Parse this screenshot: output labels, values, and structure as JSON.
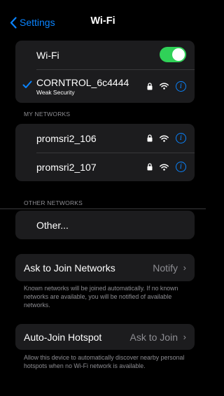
{
  "nav": {
    "back_label": "Settings",
    "title": "Wi-Fi"
  },
  "wifi_group": {
    "wifi_label": "Wi-Fi",
    "wifi_enabled": true,
    "connected": {
      "name": "CORNTROL_6c4444",
      "status": "Weak Security"
    }
  },
  "my_networks": {
    "header": "MY NETWORKS",
    "items": [
      {
        "name": "promsri2_106"
      },
      {
        "name": "promsri2_107"
      }
    ]
  },
  "other_networks": {
    "header": "OTHER NETWORKS",
    "other_label": "Other..."
  },
  "ask_to_join": {
    "label": "Ask to Join Networks",
    "value": "Notify",
    "footer": "Known networks will be joined automatically. If no known networks are available, you will be notified of available networks."
  },
  "auto_join": {
    "label": "Auto-Join Hotspot",
    "value": "Ask to Join",
    "footer": "Allow this device to automatically discover nearby personal hotspots when no Wi-Fi network is available."
  },
  "colors": {
    "accent": "#0a84ff",
    "toggle_on": "#30d158",
    "background": "#000000",
    "cell": "#1c1c1e",
    "secondary_text": "#8e8e93"
  },
  "icons": [
    "chevron-left-icon",
    "checkmark-icon",
    "lock-icon",
    "wifi-icon",
    "info-icon",
    "chevron-right-icon"
  ]
}
